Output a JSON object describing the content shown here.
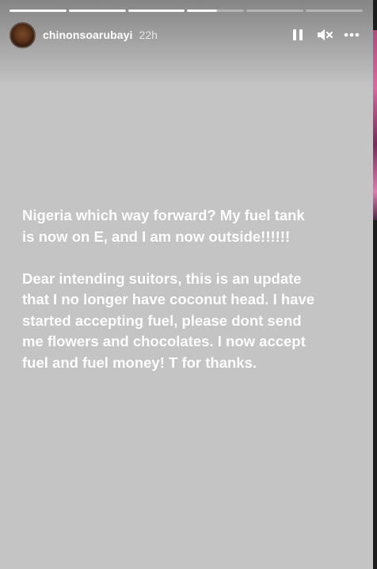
{
  "story": {
    "username": "chinonsoarubayi",
    "time_ago": "22h",
    "progress": [
      1,
      1,
      1,
      0.52,
      0,
      0
    ],
    "paragraphs": [
      "Nigeria which way forward? My fuel tank\nis now on E, and I am now outside!!!!!!",
      "Dear intending suitors, this is an update\nthat I no longer have coconut head. I have\nstarted accepting fuel, please dont send\nme flowers and chocolates. I now accept\nfuel and fuel money! T for thanks."
    ],
    "background_color": "#c4c4c4",
    "text_color": "#ffffff"
  },
  "controls": {
    "pause_icon": "pause-icon",
    "mute_icon": "speaker-muted-icon",
    "more_icon": "more-horizontal-icon"
  }
}
